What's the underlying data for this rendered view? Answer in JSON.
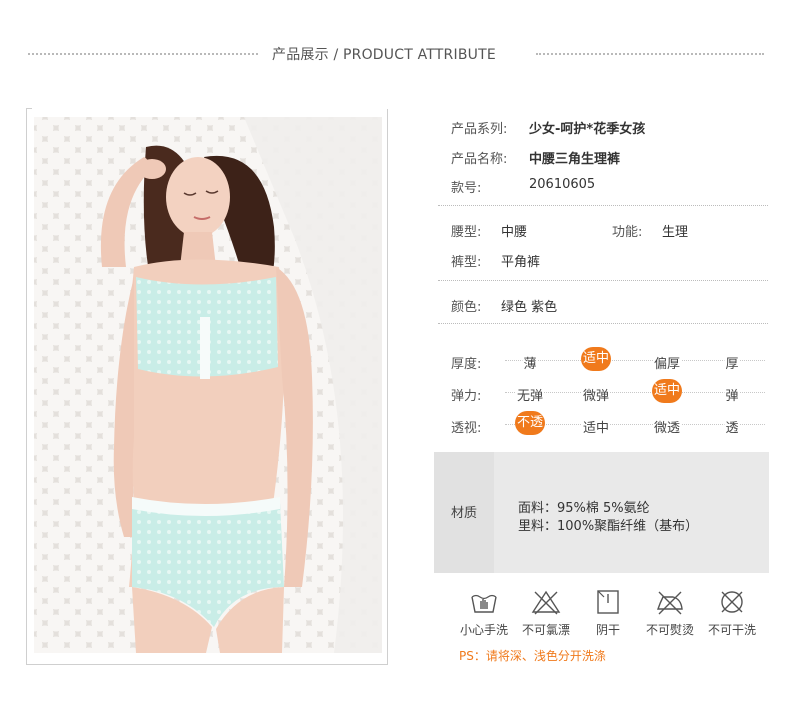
{
  "header": {
    "title": "产品展示 / PRODUCT ATTRIBUTE"
  },
  "attributes": {
    "series": {
      "label": "产品系列:",
      "value": "少女-呵护*花季女孩"
    },
    "name": {
      "label": "产品名称:",
      "value": "中腰三角生理裤"
    },
    "sku": {
      "label": "款号:",
      "value": "20610605"
    },
    "waist": {
      "label": "腰型:",
      "value": "中腰"
    },
    "function": {
      "label": "功能:",
      "value": "生理"
    },
    "leg": {
      "label": "裤型:",
      "value": "平角裤"
    },
    "color": {
      "label": "颜色:",
      "value": "绿色  紫色"
    }
  },
  "scales": [
    {
      "label": "厚度:",
      "options": [
        "薄",
        "适中",
        "偏厚",
        "厚"
      ],
      "selected": 1
    },
    {
      "label": "弹力:",
      "options": [
        "无弹",
        "微弹",
        "适中",
        "弹"
      ],
      "selected": 2
    },
    {
      "label": "透视:",
      "options": [
        "不透",
        "适中",
        "微透",
        "透"
      ],
      "selected": 0
    }
  ],
  "material": {
    "label": "材质",
    "face": "面料：95%棉 5%氨纶",
    "lining": "里料：100%聚酯纤维（基布）"
  },
  "care": [
    {
      "icon": "hand-wash-icon",
      "label": "小心手洗"
    },
    {
      "icon": "no-bleach-icon",
      "label": "不可氯漂"
    },
    {
      "icon": "line-dry-icon",
      "label": "阴干"
    },
    {
      "icon": "no-iron-icon",
      "label": "不可熨烫"
    },
    {
      "icon": "no-dry-clean-icon",
      "label": "不可干洗"
    }
  ],
  "note": "PS：请将深、浅色分开洗涤",
  "colors": {
    "accent": "#f07a1c",
    "panel": "#e9e9e9",
    "garment": "#c8ece6"
  }
}
